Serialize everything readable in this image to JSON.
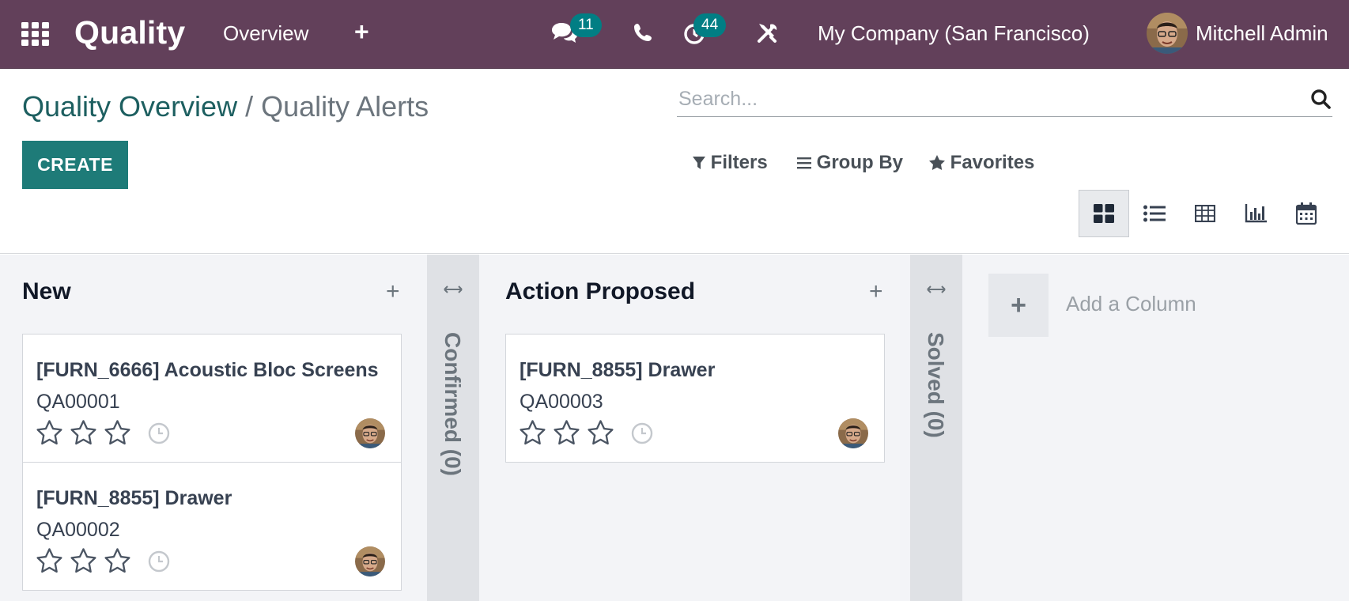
{
  "navbar": {
    "app_title": "Quality",
    "menu_overview": "Overview",
    "menu_plus": "+",
    "messages_badge": "11",
    "activities_badge": "44",
    "company": "My Company (San Francisco)",
    "user_name": "Mitchell Admin"
  },
  "control_panel": {
    "breadcrumb_parent": "Quality Overview",
    "breadcrumb_separator": " / ",
    "breadcrumb_current": "Quality Alerts",
    "create_label": "CREATE",
    "search_placeholder": "Search...",
    "filters_label": "Filters",
    "groupby_label": "Group By",
    "favorites_label": "Favorites",
    "active_view": "kanban"
  },
  "kanban": {
    "columns": [
      {
        "title": "New",
        "add": "+",
        "cards": [
          {
            "title": "[FURN_6666] Acoustic Bloc Screens",
            "ref": "QA00001"
          },
          {
            "title": "[FURN_8855] Drawer",
            "ref": "QA00002"
          }
        ]
      },
      {
        "folded_label": "Confirmed (0)"
      },
      {
        "title": "Action Proposed",
        "add": "+",
        "cards": [
          {
            "title": "[FURN_8855] Drawer",
            "ref": "QA00003"
          }
        ]
      },
      {
        "folded_label": "Solved (0)"
      }
    ],
    "add_column_plus": "+",
    "add_column_label": "Add a Column"
  },
  "colors": {
    "navbar": "#62405a",
    "primary": "#1e7b78",
    "badge": "#017e84",
    "breadcrumb_link": "#1d5f60"
  },
  "icons": [
    "apps-icon",
    "chat-icon",
    "phone-icon",
    "activity-clock-icon",
    "tools-icon",
    "search-icon",
    "filter-icon",
    "groupby-icon",
    "favorite-star-icon",
    "kanban-view-icon",
    "list-view-icon",
    "pivot-view-icon",
    "graph-view-icon",
    "calendar-view-icon",
    "star-icon",
    "clock-icon",
    "expand-arrow-icon"
  ]
}
